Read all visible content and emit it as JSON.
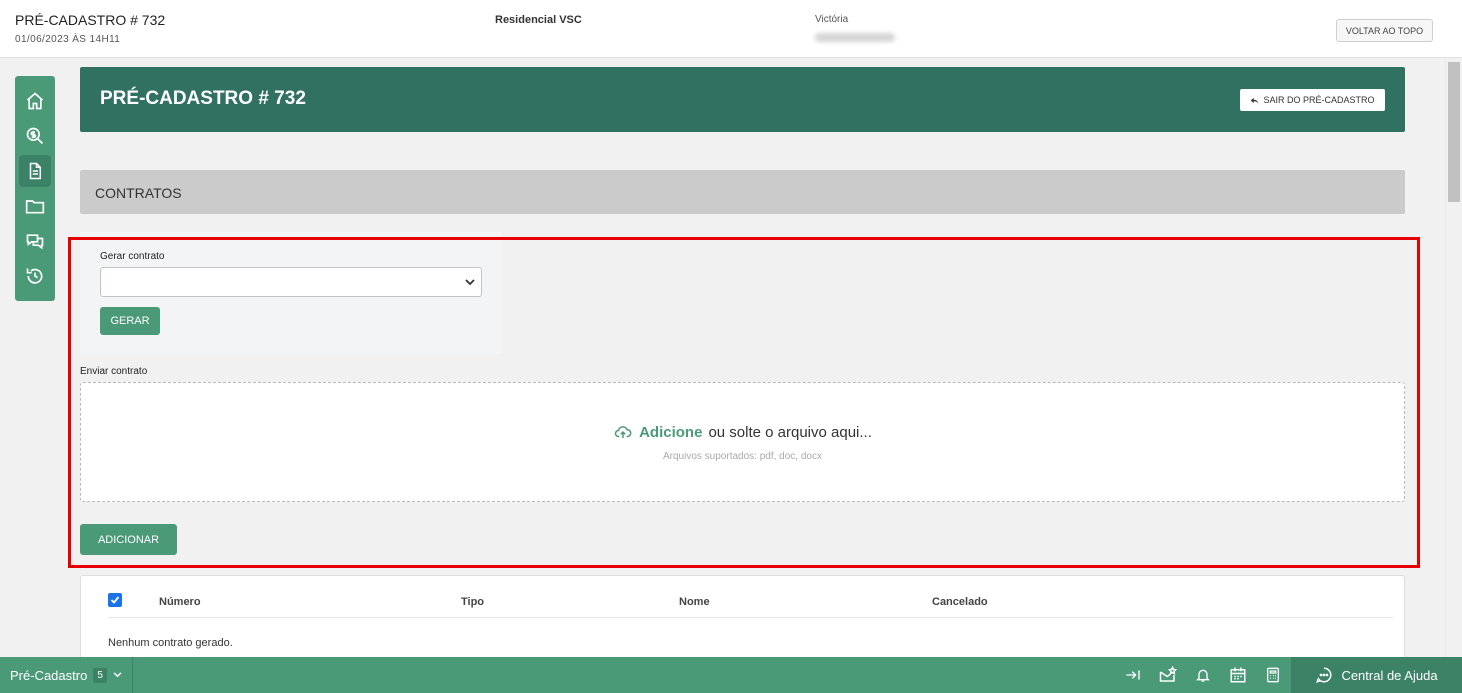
{
  "topbar": {
    "title": "PRÉ-CADASTRO # 732",
    "date": "01/06/2023 ÀS 14H11",
    "residencial": "Residencial VSC",
    "user": "Victória",
    "back_to_top": "VOLTAR AO TOPO"
  },
  "sidebar": {
    "items": [
      {
        "icon": "home-icon"
      },
      {
        "icon": "search-money-icon"
      },
      {
        "icon": "document-icon",
        "active": true
      },
      {
        "icon": "folder-icon"
      },
      {
        "icon": "chat-icon"
      },
      {
        "icon": "history-icon"
      }
    ]
  },
  "header": {
    "title": "PRÉ-CADASTRO # 732",
    "exit_label": "SAIR DO PRÉ-CADASTRO"
  },
  "section": {
    "title": "CONTRATOS"
  },
  "generate": {
    "label": "Gerar contrato",
    "select_value": "",
    "button": "GERAR"
  },
  "upload": {
    "label": "Enviar contrato",
    "add_link": "Adicione",
    "drop_text": "ou solte o arquivo aqui...",
    "supported": "Arquivos suportados: pdf, doc, docx",
    "button": "ADICIONAR"
  },
  "table": {
    "columns": [
      "Número",
      "Tipo",
      "Nome",
      "Cancelado"
    ],
    "empty_text": "Nenhum contrato gerado."
  },
  "bottombar": {
    "tab_label": "Pré-Cadastro",
    "tab_count": "5",
    "help_label": "Central de Ajuda"
  },
  "colors": {
    "accent": "#4a9a78",
    "header": "#307162",
    "highlight": "#e60000"
  }
}
